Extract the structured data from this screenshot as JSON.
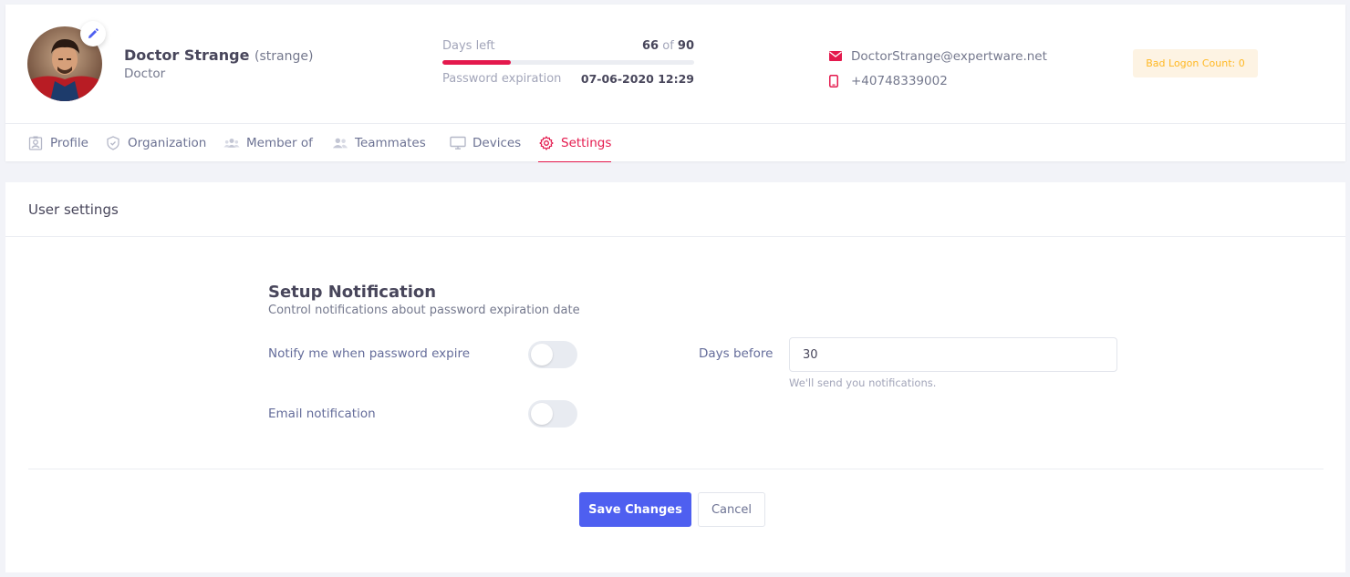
{
  "user": {
    "name": "Doctor Strange",
    "login": "(strange)",
    "role": "Doctor"
  },
  "password": {
    "days_left_label": "Days left",
    "days_left": "66",
    "of_label": "of",
    "days_total": "90",
    "days_left_fraction": 0.27,
    "expiration_label": "Password expiration",
    "expiration_date": "07-06-2020 12:29"
  },
  "contact": {
    "email": "DoctorStrange@expertware.net",
    "phone": "+40748339002"
  },
  "badge": {
    "label": "Bad Logon Count: 0"
  },
  "tabs": [
    {
      "label": "Profile",
      "icon": "profile-icon"
    },
    {
      "label": "Organization",
      "icon": "shield-icon"
    },
    {
      "label": "Member of",
      "icon": "group-icon"
    },
    {
      "label": "Teammates",
      "icon": "users-icon"
    },
    {
      "label": "Devices",
      "icon": "monitor-icon"
    },
    {
      "label": "Settings",
      "icon": "gear-icon",
      "active": true
    }
  ],
  "settings": {
    "card_title": "User settings",
    "section_title": "Setup Notification",
    "section_subtitle": "Control notifications about password expiration date",
    "notify_label": "Notify me when password expire",
    "notify_on": false,
    "email_label": "Email notification",
    "email_on": false,
    "days_before_label": "Days before",
    "days_before_value": "30",
    "hint": "We'll send you notifications."
  },
  "actions": {
    "save_label": "Save Changes",
    "cancel_label": "Cancel"
  },
  "colors": {
    "accent": "#e4194d",
    "primary": "#4e5ff0",
    "warning": "#ffb822"
  }
}
